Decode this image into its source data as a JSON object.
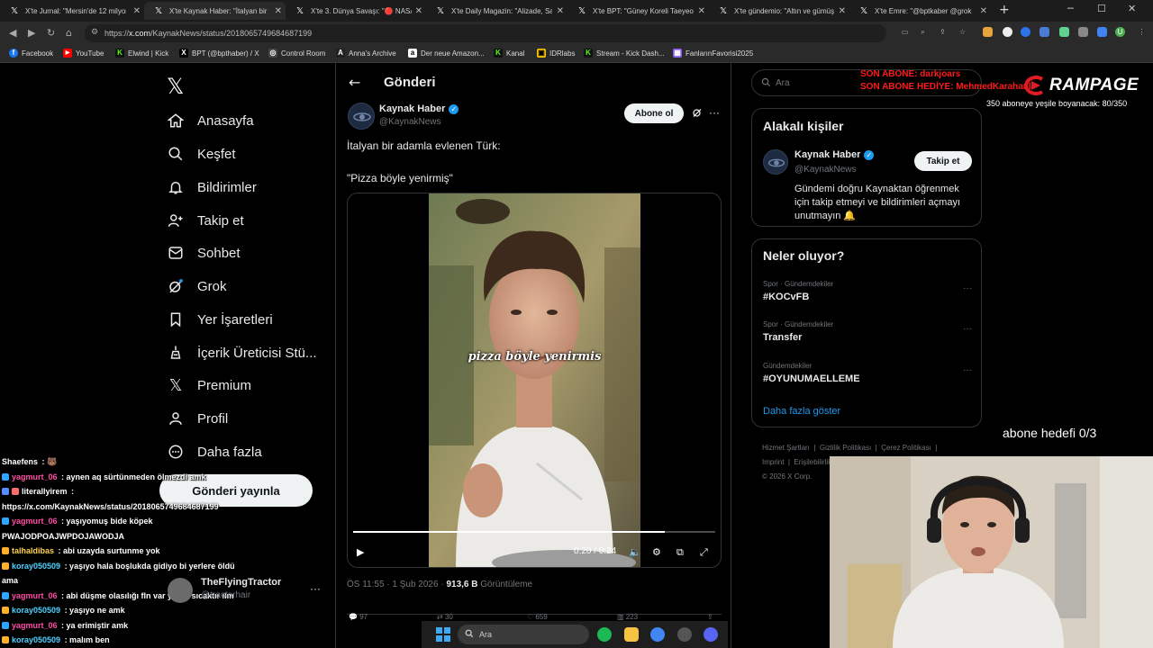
{
  "browser": {
    "tabs": [
      {
        "title": "X'te Jurnal: \"Mersin'de 12 milyon"
      },
      {
        "title": "X'te Kaynak Haber: \"İtalyan bir"
      },
      {
        "title": "X'te 3. Dünya Savaşı: \"🔴 NASA"
      },
      {
        "title": "X'te Daily Magazin: \"Alizade, Sa"
      },
      {
        "title": "X'te BPT: \"Güney Koreli Taeyeon"
      },
      {
        "title": "X'te gündemio: \"Altın ve gümüş"
      },
      {
        "title": "X'te Emre: \"@bptkaber @grok"
      }
    ],
    "url_prefix": "https://",
    "url_host": "x.com",
    "url_path": "/KaynakNews/status/2018065749684687199",
    "bookmarks": [
      {
        "label": "Facebook",
        "color": "#1877f2",
        "glyph": "f"
      },
      {
        "label": "YouTube",
        "color": "#ff0000",
        "glyph": "▶"
      },
      {
        "label": "Elwind | Kick",
        "color": "#53fc18",
        "glyph": "K"
      },
      {
        "label": "BPT (@bpthaber) / X",
        "color": "#000000",
        "glyph": "X"
      },
      {
        "label": "Control Room",
        "color": "#444444",
        "glyph": "◎"
      },
      {
        "label": "Anna's Archive",
        "color": "#222222",
        "glyph": "A"
      },
      {
        "label": "Der neue Amazon...",
        "color": "#ffffff",
        "glyph": "a"
      },
      {
        "label": "Kanal",
        "color": "#53fc18",
        "glyph": "K"
      },
      {
        "label": "IDRlabs",
        "color": "#f5c400",
        "glyph": "▣"
      },
      {
        "label": "Stream - Kick Dash...",
        "color": "#53fc18",
        "glyph": "K"
      },
      {
        "label": "FanlarınFavorisi2025",
        "color": "#8a5cf5",
        "glyph": "▦"
      }
    ]
  },
  "sidebar": {
    "items": [
      {
        "label": "Anasayfa",
        "icon": "home-icon"
      },
      {
        "label": "Keşfet",
        "icon": "search-icon"
      },
      {
        "label": "Bildirimler",
        "icon": "bell-icon"
      },
      {
        "label": "Takip et",
        "icon": "follow-icon"
      },
      {
        "label": "Sohbet",
        "icon": "chat-icon"
      },
      {
        "label": "Grok",
        "icon": "grok-icon"
      },
      {
        "label": "Yer İşaretleri",
        "icon": "bookmark-icon"
      },
      {
        "label": "İçerik Üreticisi Stü...",
        "icon": "creator-icon"
      },
      {
        "label": "Premium",
        "icon": "x-logo-icon"
      },
      {
        "label": "Profil",
        "icon": "profile-icon"
      },
      {
        "label": "Daha fazla",
        "icon": "more-icon"
      }
    ],
    "post_button": "Gönderi yayınla",
    "account": {
      "name": "TheFlyingTractor",
      "handle": "@tractorhair",
      "more": "···"
    }
  },
  "post": {
    "header_title": "Gönderi",
    "author_name": "Kaynak Haber",
    "author_handle": "@KaynakNews",
    "follow_label": "Abone ol",
    "text_line1": "İtalyan bir adamla evlenen Türk:",
    "text_line2": "\"Pizza böyle yenirmiş\"",
    "video": {
      "subtitle": "pizza böyle yenirmis",
      "time": "0:20 / 0:24",
      "progress": 0.86
    },
    "time_date": "ÖS 11:55 · 1 Şub 2026 · ",
    "views": "913,6 B",
    "views_label": " Görüntüleme",
    "actions": {
      "replies": "97",
      "reposts": "30",
      "likes": "659",
      "views": "223"
    }
  },
  "right": {
    "search_placeholder": "Ara",
    "related_title": "Alakalı kişiler",
    "related": {
      "name": "Kaynak Haber",
      "handle": "@KaynakNews",
      "follow_label": "Takip et",
      "bio": "Gündemi doğru Kaynaktan öğrenmek için takip etmeyi ve bildirimleri açmayı unutmayın 🔔"
    },
    "trends_title": "Neler oluyor?",
    "trends": [
      {
        "context": "Spor · Gündemdekiler",
        "name": "#KOCvFB"
      },
      {
        "context": "Spor · Gündemdekiler",
        "name": "Transfer"
      },
      {
        "context": "Gündemdekiler",
        "name": "#OYUNUMAELLEME"
      }
    ],
    "show_more": "Daha fazla göster",
    "footer": {
      "links": [
        "Hizmet Şartları",
        "Gizlilik Politikası",
        "Çerez Politikası",
        "Imprint",
        "Erişilebilirlik"
      ],
      "copyright": "© 2026 X Corp."
    }
  },
  "overlay": {
    "last_sub": "SON ABONE: darkjoars",
    "last_gift": "SON ABONE HEDİYE: MehmedKarahanli",
    "brand": "RAMPAGE",
    "sub_goal": "350 aboneye yeşile boyanacak: 80/350",
    "sub_target": "abone hedefi 0/3"
  },
  "chat": [
    {
      "user": "Shaefens",
      "text": " : 🐻",
      "color": "#ffffff"
    },
    {
      "user": "yagmurt_06",
      "text": " : aynen aq sürtünmeden ölmezdi amk",
      "color": "#ff4da6"
    },
    {
      "user": "literallyirem",
      "text": " :",
      "color": "#ffffff"
    },
    {
      "user": "",
      "text": "https://x.com/KaynakNews/status/2018065749684687199",
      "color": "#ffffff"
    },
    {
      "user": "yagmurt_06",
      "text": " : yaşıyomuş bide köpek",
      "color": "#ff4da6"
    },
    {
      "user": "",
      "text": "PWAJODPOAJWPDOJAWODJA",
      "color": "#ffffff"
    },
    {
      "user": "talhaldibas",
      "text": " : abi uzayda surtunme yok",
      "color": "#ffd24d"
    },
    {
      "user": "koray050509",
      "text": " : yaşıyo hala boşlukda gidiyo bi yerlere öldü",
      "color": "#4dd2ff"
    },
    {
      "user": "",
      "text": "ama",
      "color": "#ffffff"
    },
    {
      "user": "yagmurt_06",
      "text": " : abi düşme olasılığı fln var yanar sıcaktır ılm",
      "color": "#ff4da6"
    },
    {
      "user": "koray050509",
      "text": " : yaşıyo ne amk",
      "color": "#4dd2ff"
    },
    {
      "user": "yagmurt_06",
      "text": " : ya erimiştir amk",
      "color": "#ff4da6"
    },
    {
      "user": "koray050509",
      "text": " : malım ben",
      "color": "#4dd2ff"
    }
  ],
  "taskbar": {
    "search_placeholder": "Ara"
  }
}
